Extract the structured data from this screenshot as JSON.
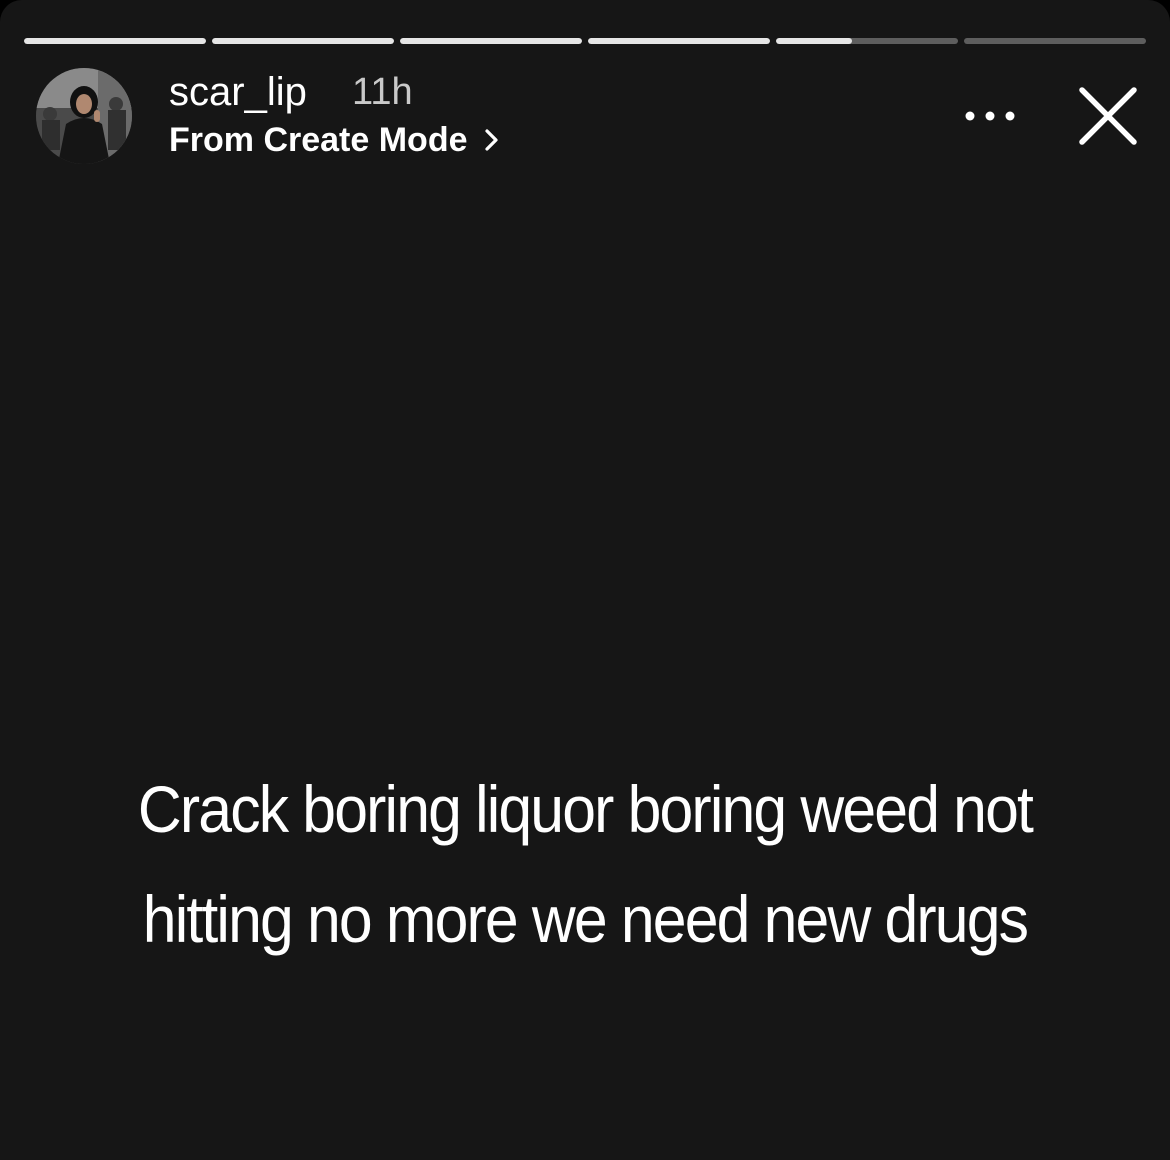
{
  "story": {
    "progress_segments": [
      1,
      1,
      1,
      1,
      0.42,
      0
    ],
    "colors": {
      "background": "#161616",
      "progress_filled": "#e6e6e6",
      "progress_empty": "#5e5e5e"
    }
  },
  "header": {
    "username": "scar_lip",
    "time_ago": "11h",
    "source_label": "From Create Mode",
    "source_chevron_icon": "chevron-right-icon",
    "more_icon": "more-options-icon",
    "close_icon": "close-icon"
  },
  "content": {
    "caption": "Crack boring liquor boring weed not hitting no more we need new drugs"
  }
}
